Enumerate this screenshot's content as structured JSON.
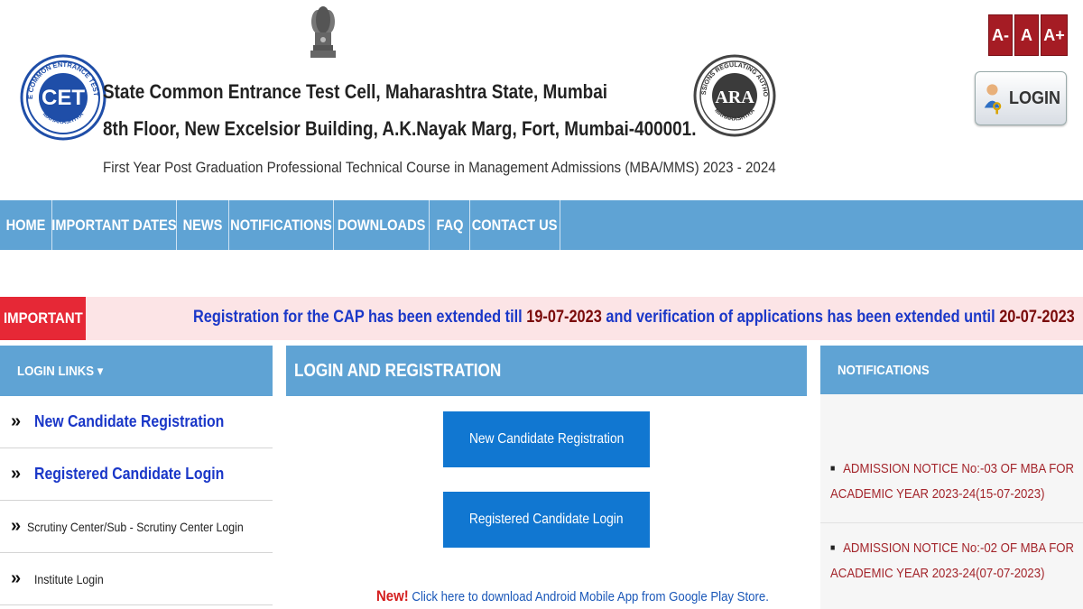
{
  "header": {
    "line1": "State Common Entrance Test Cell, Maharashtra State, Mumbai",
    "line2": "8th Floor, New Excelsior Building, A.K.Nayak Marg, Fort, Mumbai-400001.",
    "subtitle": "First Year Post Graduation Professional Technical Course in Management Admissions (MBA/MMS) 2023 - 2024",
    "cet_logo": {
      "center_text": "CET",
      "ring_text_top": "STATE COMMON ENTRANCE TEST CELL",
      "ring_text_bottom": "MAHARASHTRA"
    },
    "ara_logo": {
      "center_text": "ARA",
      "ring_text_top": "ADMISSIONS REGULATING AUTHORITY",
      "ring_text_bottom": "MAHARASHTRA"
    },
    "font_controls": [
      "A-",
      "A",
      "A+"
    ],
    "login_label": "LOGIN"
  },
  "nav": {
    "items": [
      "HOME",
      "IMPORTANT DATES",
      "NEWS",
      "NOTIFICATIONS",
      "DOWNLOADS",
      "FAQ",
      "CONTACT US"
    ]
  },
  "notice": {
    "label": "IMPORTANT",
    "text_a": "Registration for the CAP has been extended till ",
    "date_a": "19-07-2023",
    "text_b": " and verification of applications has been extended until ",
    "date_b": "20-07-2023"
  },
  "left_panel": {
    "title": "LOGIN LINKS ▾",
    "items": [
      "New Candidate Registration",
      "Registered Candidate Login",
      "Scrutiny Center/Sub - Scrutiny Center Login",
      "Institute Login"
    ]
  },
  "main_panel": {
    "title": "LOGIN AND REGISTRATION",
    "btn_new": "New Candidate Registration",
    "btn_registered": "Registered Candidate Login",
    "app_new": "New!",
    "app_link": " Click here to download Android Mobile App from Google Play Store."
  },
  "notifications": {
    "title": "NOTIFICATIONS",
    "items": [
      "ADMISSION NOTICE No:-03 OF MBA FOR ACADEMIC YEAR 2023-24(15-07-2023)",
      "ADMISSION NOTICE No:-02 OF MBA FOR ACADEMIC YEAR 2023-24(07-07-2023)"
    ]
  }
}
